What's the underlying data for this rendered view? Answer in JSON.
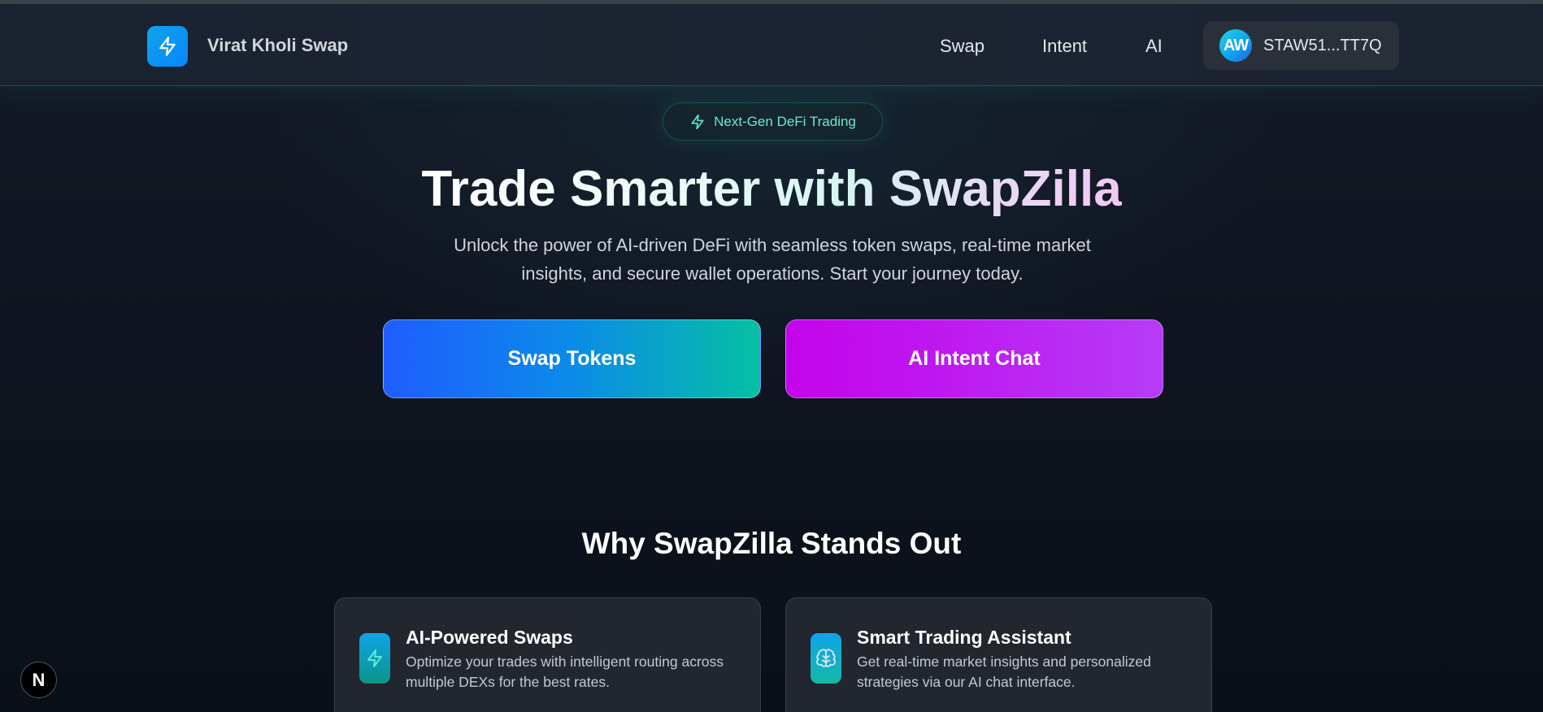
{
  "nav": {
    "brand": "Virat Kholi Swap",
    "logo_icon": "lightning-icon",
    "links": [
      {
        "label": "Swap"
      },
      {
        "label": "Intent"
      },
      {
        "label": "AI"
      }
    ],
    "wallet": {
      "avatar_initials": "AW",
      "address": "STAW51...TT7Q"
    }
  },
  "hero": {
    "badge_icon": "lightning-icon",
    "badge_text": "Next-Gen DeFi Trading",
    "title": "Trade Smarter with SwapZilla",
    "subtitle": "Unlock the power of AI-driven DeFi with seamless token swaps, real-time market insights, and secure wallet operations. Start your journey today.",
    "cta_primary": "Swap Tokens",
    "cta_secondary": "AI Intent Chat"
  },
  "features": {
    "title": "Why SwapZilla Stands Out",
    "cards": [
      {
        "icon": "lightning-icon",
        "title": "AI-Powered Swaps",
        "description": "Optimize your trades with intelligent routing across multiple DEXs for the best rates."
      },
      {
        "icon": "brain-icon",
        "title": "Smart Trading Assistant",
        "description": "Get real-time market insights and personalized strategies via our AI chat interface."
      }
    ]
  },
  "dev_badge": {
    "label": "N"
  },
  "colors": {
    "accent_teal": "#2dd4bf",
    "primary_blue": "#1f5dff",
    "primary_purple": "#c404ea",
    "background": "#0c111b"
  }
}
